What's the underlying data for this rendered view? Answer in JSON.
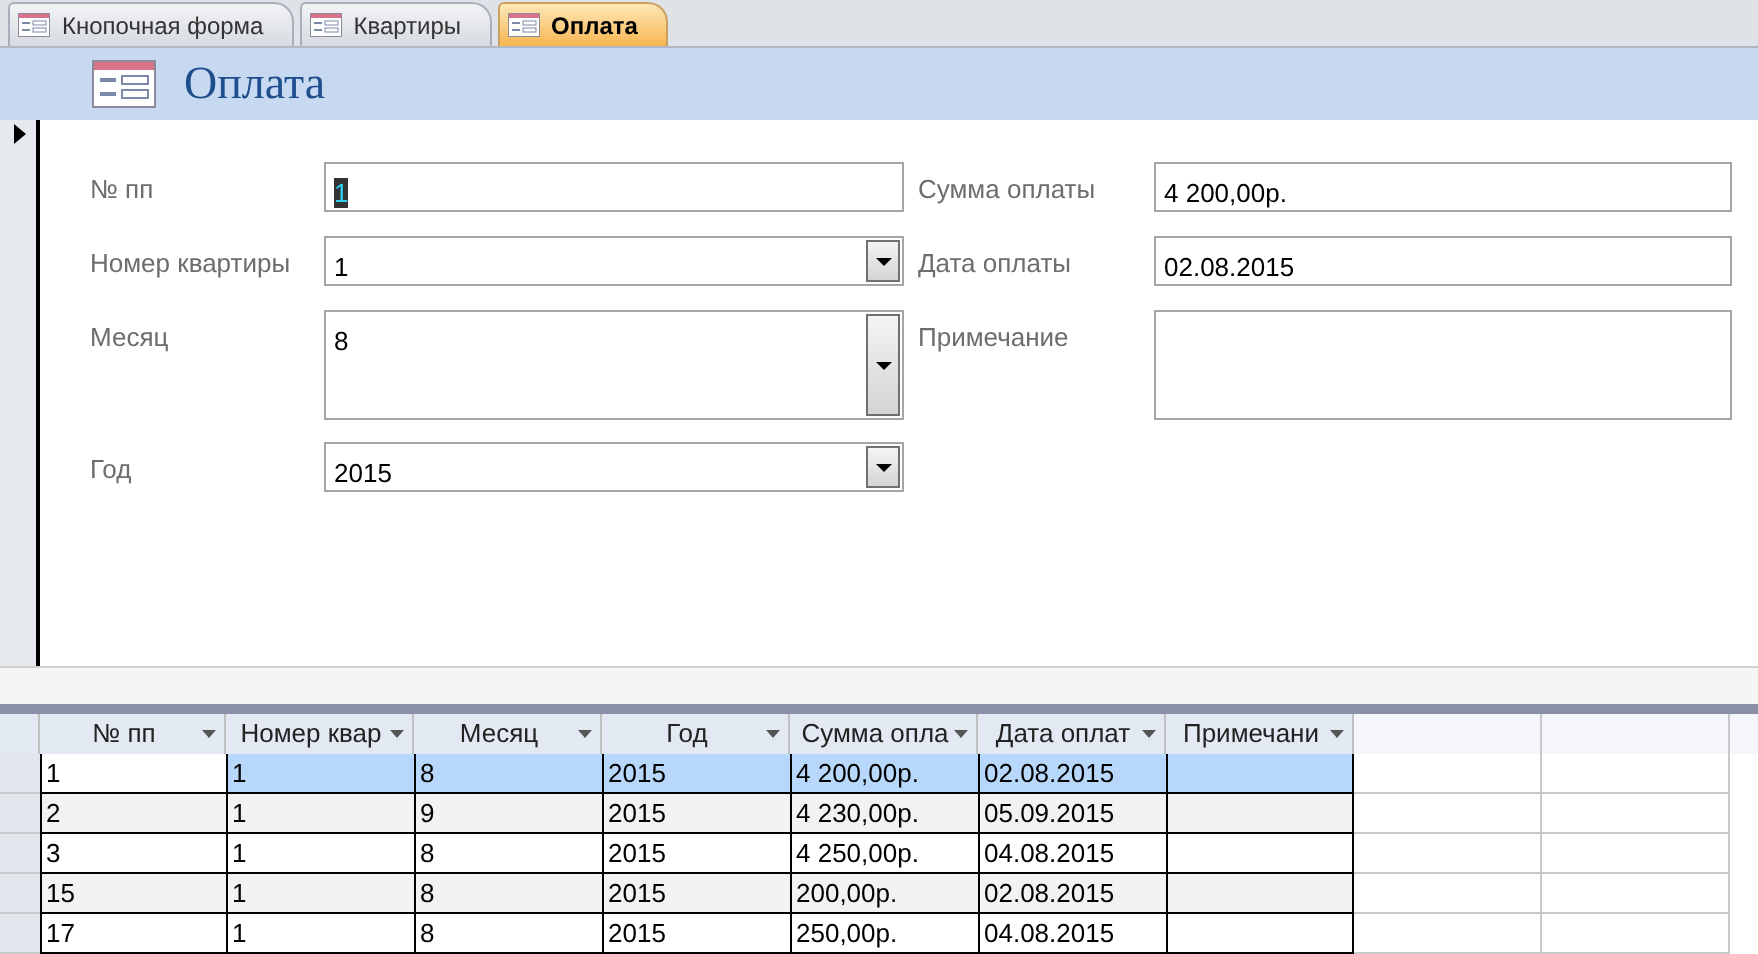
{
  "tabs": [
    {
      "label": "Кнопочная форма",
      "selected": false
    },
    {
      "label": "Квартиры",
      "selected": false
    },
    {
      "label": "Оплата",
      "selected": true
    }
  ],
  "form": {
    "title": "Оплата",
    "left_fields": [
      {
        "label": "№ пп",
        "value": "1",
        "kind": "text",
        "value_selected": true
      },
      {
        "label": "Номер квартиры",
        "value": "1",
        "kind": "combo",
        "value_selected": false
      },
      {
        "label": "Месяц",
        "value": "8",
        "kind": "list",
        "value_selected": false
      },
      {
        "label": "Год",
        "value": "2015",
        "kind": "combo",
        "value_selected": false
      }
    ],
    "right_fields": [
      {
        "label": "Сумма оплаты",
        "value": "4 200,00р.",
        "kind": "text"
      },
      {
        "label": "Дата оплаты",
        "value": "02.08.2015",
        "kind": "text"
      },
      {
        "label": "Примечание",
        "kind": "memo"
      }
    ]
  },
  "datasheet": {
    "columns": [
      "№ пп",
      "Номер квар",
      "Месяц",
      "Год",
      "Сумма опла",
      "Дата оплат",
      "Примечани"
    ],
    "rows": [
      {
        "cells": [
          "1",
          "1",
          "8",
          "2015",
          "4 200,00р.",
          "02.08.2015",
          ""
        ],
        "selected": true
      },
      {
        "cells": [
          "2",
          "1",
          "9",
          "2015",
          "4 230,00р.",
          "05.09.2015",
          ""
        ],
        "selected": false
      },
      {
        "cells": [
          "3",
          "1",
          "8",
          "2015",
          "4 250,00р.",
          "04.08.2015",
          ""
        ],
        "selected": false
      },
      {
        "cells": [
          "15",
          "1",
          "8",
          "2015",
          "200,00р.",
          "02.08.2015",
          ""
        ],
        "selected": false
      },
      {
        "cells": [
          "17",
          "1",
          "8",
          "2015",
          "250,00р.",
          "04.08.2015",
          ""
        ],
        "selected": false
      }
    ]
  }
}
